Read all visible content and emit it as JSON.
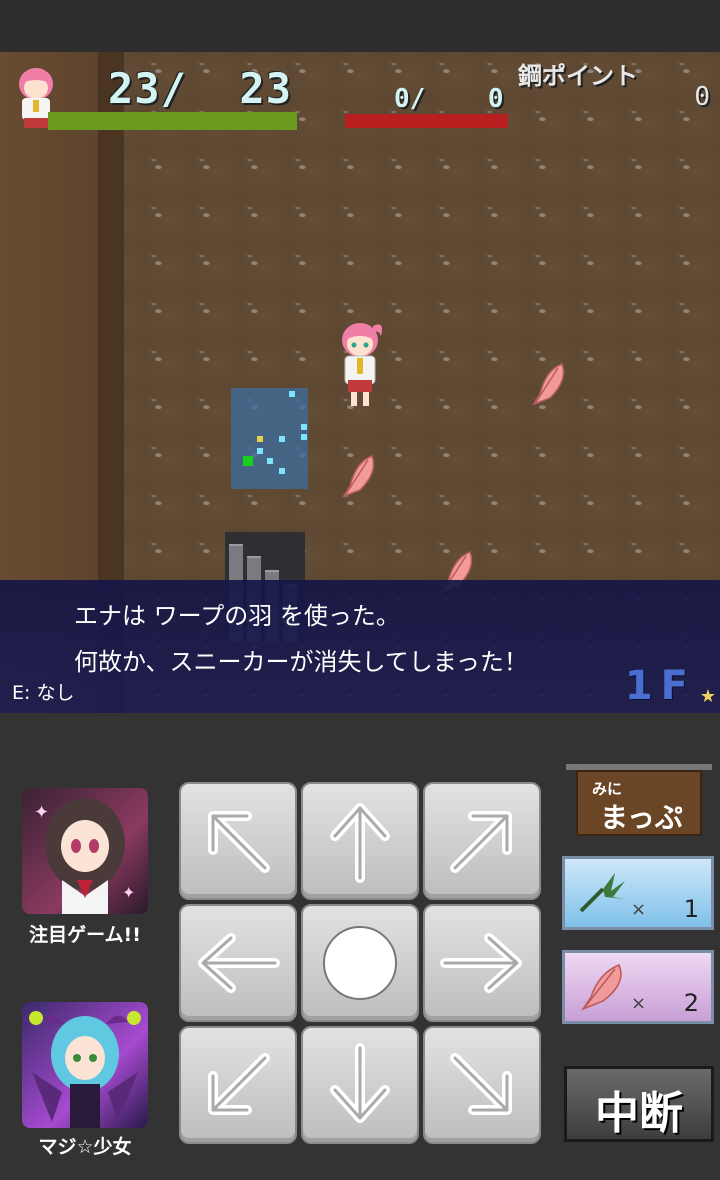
{
  "hud": {
    "hp_current": "23",
    "hp_max": "23",
    "hp_text": "23/  23",
    "hp_ratio": 1.0,
    "mp_text": "0/    0",
    "mp_ratio": 0,
    "kou_label": "鋼ポイント",
    "kou_value": "0"
  },
  "message": {
    "line1": "エナは ワープの羽 を使った。",
    "line2": "何故か、スニーカーが消失してしまった！",
    "equip": "E: なし",
    "floor": "1F",
    "star": "★"
  },
  "ads": {
    "ad1_label": "注目ゲーム!!",
    "ad2_label": "マジ☆少女"
  },
  "minimap_button": {
    "top": "みに",
    "main": "まっぷ"
  },
  "items": [
    {
      "icon": "herb-icon",
      "x": "×",
      "count": "1"
    },
    {
      "icon": "feather-icon",
      "x": "×",
      "count": "2"
    }
  ],
  "pause_label": "中断",
  "colors": {
    "hp": "#6a9a1e",
    "mp": "#b81f1f",
    "floor": "#4a6fd0"
  }
}
